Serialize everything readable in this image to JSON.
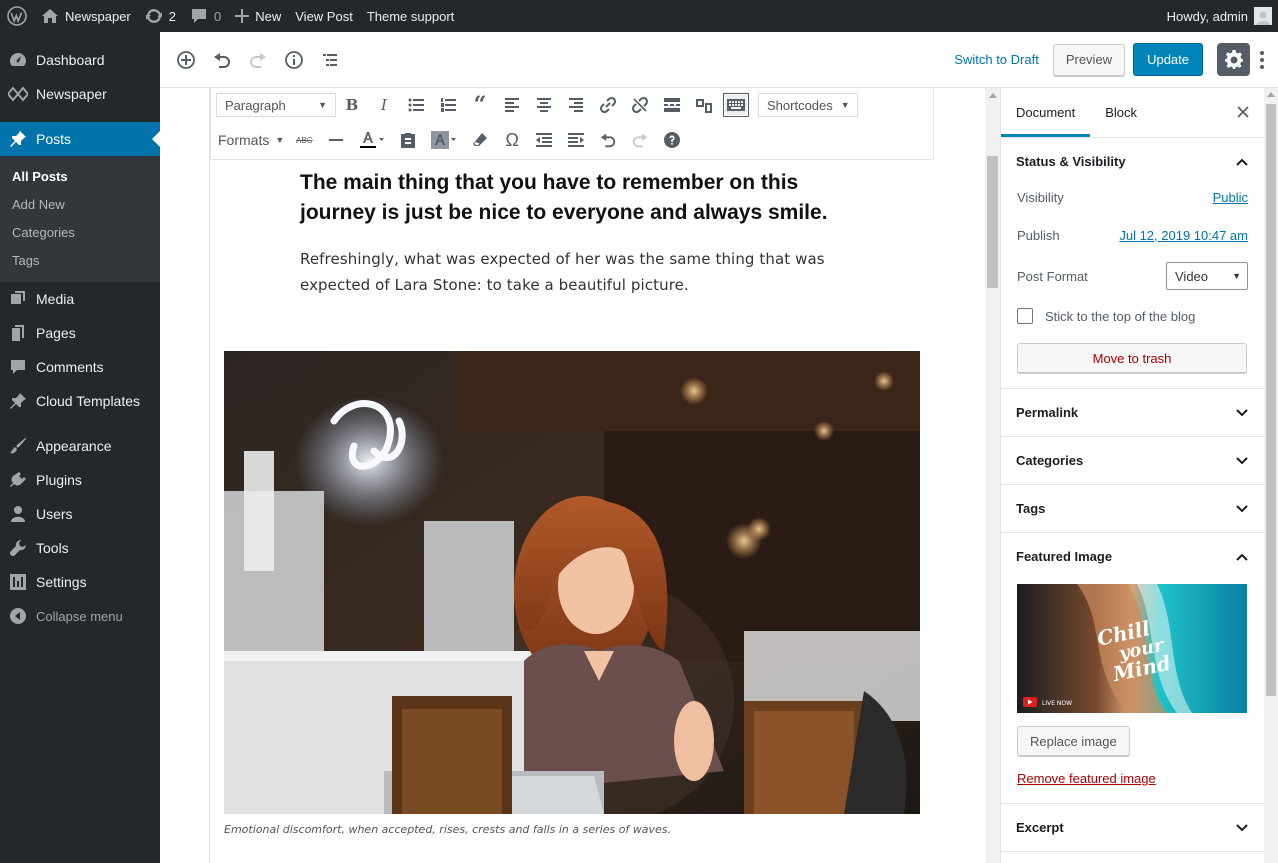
{
  "adminbar": {
    "site_name": "Newspaper",
    "updates_count": "2",
    "comments_count": "0",
    "new_label": "New",
    "view_post_label": "View Post",
    "theme_support_label": "Theme support",
    "howdy_label": "Howdy, admin"
  },
  "menu": {
    "dashboard": "Dashboard",
    "newspaper": "Newspaper",
    "posts": "Posts",
    "posts_sub": [
      "All Posts",
      "Add New",
      "Categories",
      "Tags"
    ],
    "media": "Media",
    "pages": "Pages",
    "comments": "Comments",
    "cloud_templates": "Cloud Templates",
    "appearance": "Appearance",
    "plugins": "Plugins",
    "users": "Users",
    "tools": "Tools",
    "settings": "Settings",
    "collapse": "Collapse menu"
  },
  "header": {
    "switch_to_draft": "Switch to Draft",
    "preview": "Preview",
    "update": "Update"
  },
  "toolbar": {
    "paragraph_select": "Paragraph",
    "shortcodes_select": "Shortcodes",
    "formats_label": "Formats"
  },
  "post": {
    "heading": "The main thing that you have to remember on this journey is just be nice to everyone and always smile.",
    "paragraph": "Refreshingly, what was expected of her was the same thing that was expected of Lara Stone: to take a beautiful picture.",
    "caption": "Emotional discomfort, when accepted, rises, crests and falls in a series of waves."
  },
  "sidebar": {
    "tab_document": "Document",
    "tab_block": "Block",
    "status_visibility": {
      "title": "Status & Visibility",
      "visibility_label": "Visibility",
      "visibility_value": "Public",
      "publish_label": "Publish",
      "publish_value": "Jul 12, 2019 10:47 am",
      "post_format_label": "Post Format",
      "post_format_value": "Video",
      "sticky_label": "Stick to the top of the blog",
      "trash_label": "Move to trash"
    },
    "permalink_title": "Permalink",
    "categories_title": "Categories",
    "tags_title": "Tags",
    "featured_image": {
      "title": "Featured Image",
      "overlay_text_1": "Chill",
      "overlay_text_2": "your",
      "overlay_text_3": "Mind",
      "live_now": "LIVE NOW",
      "replace_label": "Replace image",
      "remove_label": "Remove featured image"
    },
    "excerpt_title": "Excerpt"
  },
  "colors": {
    "admin_dark": "#23282d",
    "accent_blue": "#0073aa",
    "primary_button": "#0085ba",
    "danger": "#a00000"
  }
}
